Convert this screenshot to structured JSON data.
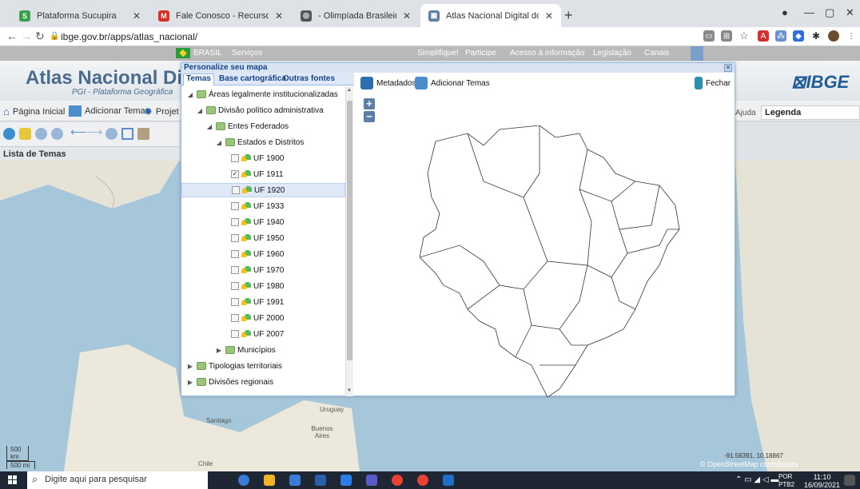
{
  "browser": {
    "tabs": [
      {
        "label": "Plataforma Sucupira",
        "color": "#3aa04b",
        "active": false
      },
      {
        "label": "Fale Conosco - Recurso - Revisão",
        "color": "#d93025",
        "active": false
      },
      {
        "label": "- Olimpíada Brasileira de Geogra",
        "color": "#555555",
        "active": false
      },
      {
        "label": "Atlas Nacional Digital do Brasil",
        "color": "#5b7fa6",
        "active": true
      }
    ],
    "url": "ibge.gov.br/apps/atlas_nacional/"
  },
  "govbar": {
    "brasil": "BRASIL",
    "servicos": "Serviços",
    "links": [
      "Simplifique!",
      "Participe",
      "Acesso à informação",
      "Legislação",
      "Canais"
    ]
  },
  "header": {
    "title": "Atlas Nacional Digi",
    "subtitle": "PGI - Plataforma Geográfica",
    "logo": "IBGE"
  },
  "toolbar": {
    "home": "Página Inicial",
    "add": "Adicionar Temas",
    "proj": "Projet",
    "ajuda": "Ajuda",
    "legenda": "Legenda"
  },
  "lista_temas": "Lista de Temas",
  "modal": {
    "title": "Personalize seu mapa",
    "tabs": [
      "Temas",
      "Base cartográfica",
      "Outras fontes"
    ],
    "metadados": "Metadados",
    "adicionar": "Adicionar Temas",
    "fechar": "Fechar",
    "tree": [
      {
        "label": "Áreas legalmente institucionalizadas",
        "level": 0,
        "arrow": "◢",
        "type": "folder"
      },
      {
        "label": "Divisão político administrativa",
        "level": 1,
        "arrow": "◢",
        "type": "folder"
      },
      {
        "label": "Entes Federados",
        "level": 2,
        "arrow": "◢",
        "type": "folder"
      },
      {
        "label": "Estados e Distritos",
        "level": 3,
        "arrow": "◢",
        "type": "folder"
      },
      {
        "label": "UF 1900",
        "level": 4,
        "type": "leaf",
        "checked": false
      },
      {
        "label": "UF 1911",
        "level": 4,
        "type": "leaf",
        "checked": true
      },
      {
        "label": "UF 1920",
        "level": 4,
        "type": "leaf",
        "checked": false,
        "selected": true
      },
      {
        "label": "UF 1933",
        "level": 4,
        "type": "leaf",
        "checked": false
      },
      {
        "label": "UF 1940",
        "level": 4,
        "type": "leaf",
        "checked": false
      },
      {
        "label": "UF 1950",
        "level": 4,
        "type": "leaf",
        "checked": false
      },
      {
        "label": "UF 1960",
        "level": 4,
        "type": "leaf",
        "checked": false
      },
      {
        "label": "UF 1970",
        "level": 4,
        "type": "leaf",
        "checked": false
      },
      {
        "label": "UF 1980",
        "level": 4,
        "type": "leaf",
        "checked": false
      },
      {
        "label": "UF 1991",
        "level": 4,
        "type": "leaf",
        "checked": false
      },
      {
        "label": "UF 2000",
        "level": 4,
        "type": "leaf",
        "checked": false
      },
      {
        "label": "UF 2007",
        "level": 4,
        "type": "leaf",
        "checked": false
      },
      {
        "label": "Municípios",
        "level": 3,
        "arrow": "▶",
        "type": "folder"
      },
      {
        "label": "Tipologias territoriais",
        "level": 0,
        "arrow": "▶",
        "type": "folder"
      },
      {
        "label": "Divisões regionais",
        "level": 0,
        "arrow": "▶",
        "type": "folder"
      }
    ]
  },
  "map": {
    "coords": "-91.56391, 10.18867",
    "osm": "© OpenStreetMap contributors",
    "scale_km": "500 km",
    "scale_mi": "500 mi",
    "labels": [
      "Uruguay",
      "Buenos Aires",
      "Santiago",
      "Chile"
    ]
  },
  "taskbar": {
    "search": "Digite aqui para pesquisar",
    "lang1": "POR",
    "lang2": "PTB2",
    "time": "11:10",
    "date": "16/09/2021"
  }
}
